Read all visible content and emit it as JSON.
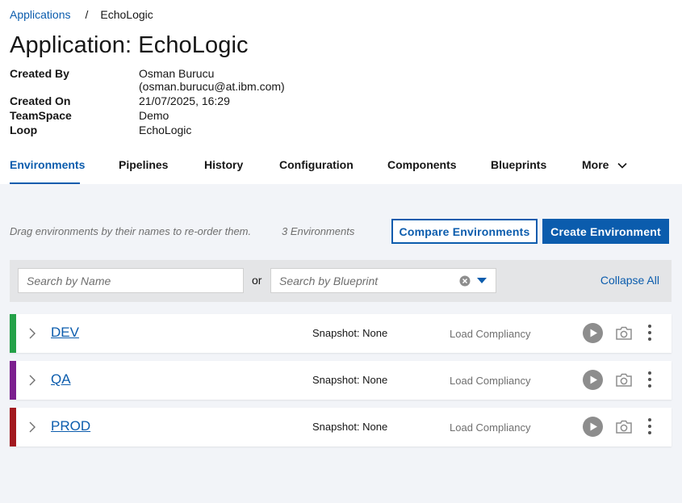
{
  "breadcrumb": {
    "root": "Applications",
    "separator": "/",
    "current": "EchoLogic"
  },
  "page_title": "Application: EchoLogic",
  "meta": {
    "created_by_label": "Created By",
    "created_by_name": "Osman Burucu",
    "created_by_email": "(osman.burucu@at.ibm.com)",
    "created_on_label": "Created On",
    "created_on_value": "21/07/2025, 16:29",
    "teamspace_label": "TeamSpace",
    "teamspace_value": "Demo",
    "loop_label": "Loop",
    "loop_value": "EchoLogic"
  },
  "tabs": [
    {
      "label": "Environments",
      "active": true
    },
    {
      "label": "Pipelines"
    },
    {
      "label": "History"
    },
    {
      "label": "Configuration"
    },
    {
      "label": "Components"
    },
    {
      "label": "Blueprints"
    },
    {
      "label": "More"
    }
  ],
  "toolbar": {
    "hint": "Drag environments by their names to re-order them.",
    "count": "3 Environments",
    "compare_label": "Compare Environments",
    "create_label": "Create Environment"
  },
  "filters": {
    "name_placeholder": "Search by Name",
    "or_label": "or",
    "blueprint_placeholder": "Search by Blueprint",
    "collapse_all": "Collapse All"
  },
  "environments": [
    {
      "name": "DEV",
      "color": "#24a148",
      "snapshot": "Snapshot: None",
      "compliancy": "Load Compliancy"
    },
    {
      "name": "QA",
      "color": "#8a3ffc",
      "snapshot": "Snapshot: None",
      "compliancy": "Load Compliancy"
    },
    {
      "name": "PROD",
      "color": "#a2191f",
      "snapshot": "Snapshot: None",
      "compliancy": "Load Compliancy"
    }
  ],
  "colors": {
    "link": "#0b5cad",
    "qa_stripe": "#7b1f8e"
  }
}
